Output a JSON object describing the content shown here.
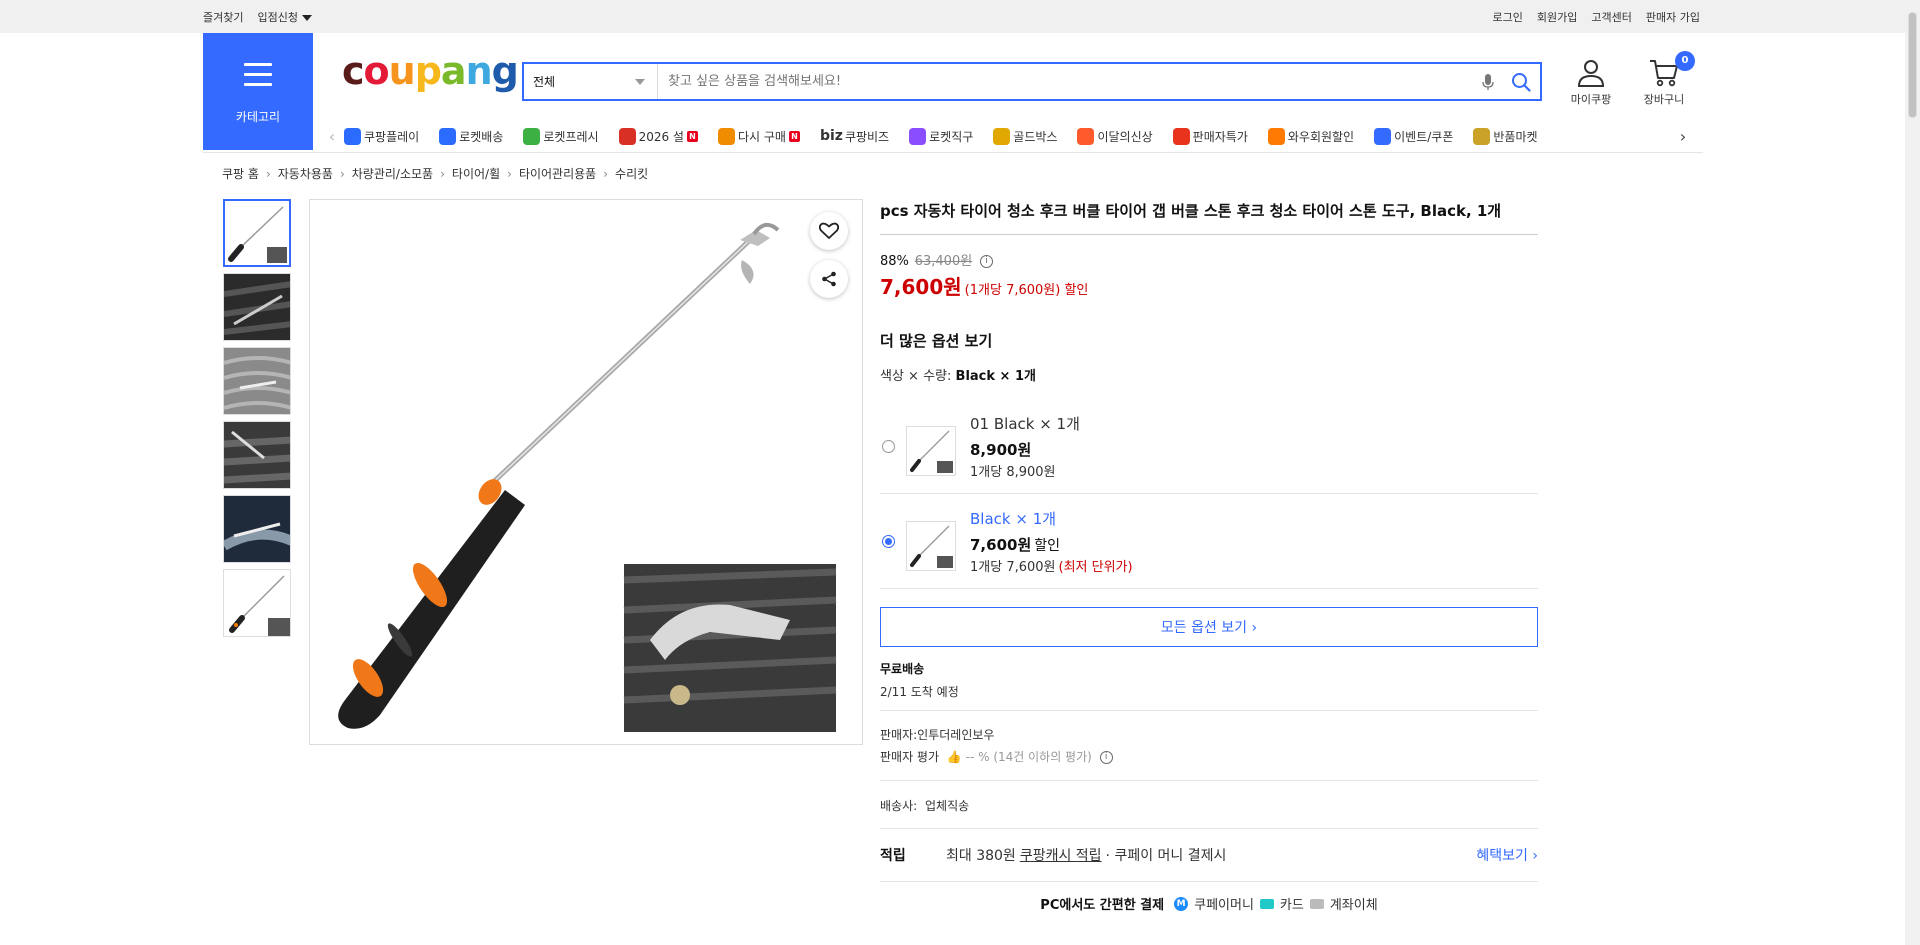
{
  "topbar": {
    "bookmark": "즐겨찾기",
    "vendor": "입점신청",
    "login": "로그인",
    "signup": "회원가입",
    "support": "고객센터",
    "seller_signup": "판매자 가입"
  },
  "header": {
    "category_label": "카테고리",
    "logo": {
      "c": "c",
      "o": "o",
      "u": "u",
      "p": "p",
      "a": "a",
      "n": "n",
      "g": "g"
    },
    "logo_colors": [
      "#5a1b1b",
      "#e31937",
      "#f7941d",
      "#f7b81d",
      "#7ab929",
      "#3ea8e0",
      "#1e5cab"
    ],
    "search_category": "전체",
    "search_placeholder": "찾고 싶은 상품을 검색해보세요!",
    "mycoupang": "마이쿠팡",
    "cart": "장바구니",
    "cart_count": "0"
  },
  "nav": [
    {
      "label": "쿠팡플레이",
      "icon": "play-icon",
      "color": "#2b6cff"
    },
    {
      "label": "로켓배송",
      "icon": "rocket-icon",
      "color": "#2b6cff"
    },
    {
      "label": "로켓프레시",
      "icon": "rocket-fresh-icon",
      "color": "#3cb043"
    },
    {
      "label": "2026 설",
      "icon": "gift-icon",
      "color": "#d93025",
      "badge": "N"
    },
    {
      "label": "다시 구매",
      "icon": "home-icon",
      "color": "#f08c00",
      "badge": "N"
    },
    {
      "label": "쿠팡비즈",
      "icon": "biz-icon",
      "color": "#346aff",
      "prefix": "biz"
    },
    {
      "label": "로켓직구",
      "icon": "globe-icon",
      "color": "#8a4dff"
    },
    {
      "label": "골드박스",
      "icon": "goldbox-icon",
      "color": "#e0a800"
    },
    {
      "label": "이달의신상",
      "icon": "new-icon",
      "color": "#ff5a2b"
    },
    {
      "label": "판매자특가",
      "icon": "percent-icon",
      "color": "#e8341c"
    },
    {
      "label": "와우회원할인",
      "icon": "wow-icon",
      "color": "#ff7a00"
    },
    {
      "label": "이벤트/쿠폰",
      "icon": "coupon-icon",
      "color": "#346aff"
    },
    {
      "label": "반품마켓",
      "icon": "market-icon",
      "color": "#c9a227"
    }
  ],
  "breadcrumb": [
    "쿠팡 홈",
    "자동차용품",
    "차량관리/소모품",
    "타이어/휠",
    "타이어관리용품",
    "수리킷"
  ],
  "product": {
    "title": "pcs 자동차 타이어 청소 후크 버클 타이어 갭 버클 스톤 후크 청소 타이어 스톤 도구, Black, 1개",
    "discount_rate": "88%",
    "original_price": "63,400원",
    "final_price": "7,600원",
    "unit_price": "(1개당 7,600원) 할인",
    "options_title": "더 많은 옵션 보기",
    "option_prefix": "색상 × 수량:",
    "option_selected": "Black × 1개",
    "options": [
      {
        "name": "01 Black × 1개",
        "price": "8,900원",
        "discount": "",
        "unit": "1개당 8,900원",
        "lowest": "",
        "selected": false
      },
      {
        "name": "Black × 1개",
        "price": "7,600원",
        "discount": "할인",
        "unit": "1개당 7,600원",
        "lowest": "(최저 단위가)",
        "selected": true
      }
    ],
    "all_options": "모든 옵션 보기 ›",
    "shipping_title": "무료배송",
    "shipping_eta": "2/11 도착 예정",
    "seller": "판매자:인투더레인보우",
    "seller_rating_label": "판매자 평가",
    "seller_rating_value": "-- % (14건 이하의 평가)",
    "courier_label": "배송사:",
    "courier_value": "업체직송",
    "reward_label": "적립",
    "reward_prefix": "최대 380원",
    "reward_link": "쿠팡캐시 적립",
    "reward_suffix": "· 쿠페이 머니 결제시",
    "reward_more": "혜택보기 ›",
    "pay_title": "PC에서도 간편한 결제",
    "pay_money": "쿠페이머니",
    "pay_card": "카드",
    "pay_bank": "계좌이체"
  },
  "colors": {
    "accent": "#346aff",
    "price_red": "#cc0000"
  }
}
